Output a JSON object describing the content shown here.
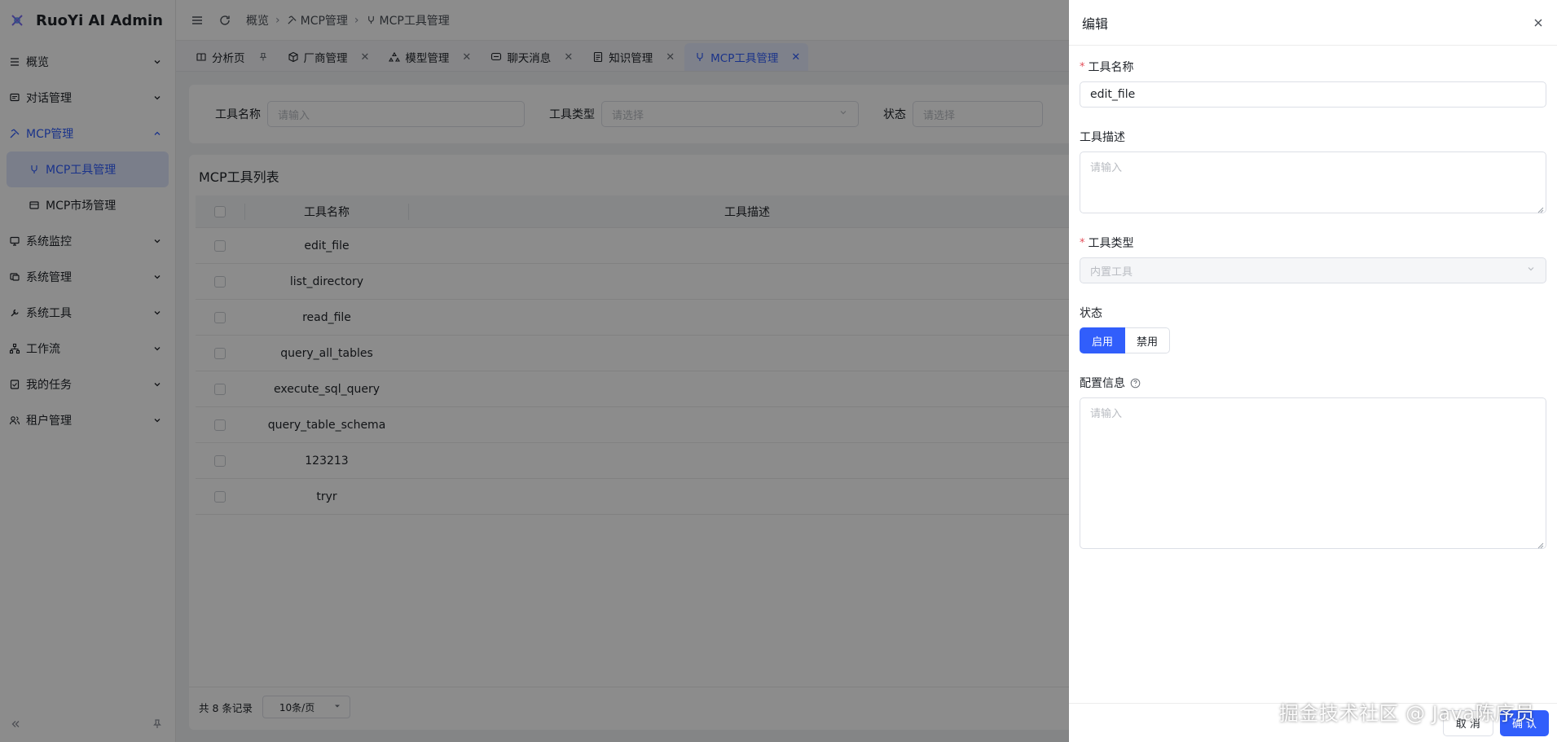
{
  "app": {
    "title": "RuoYi AI Admin"
  },
  "sidebar": {
    "items": [
      {
        "label": "概览",
        "icon": "menu-lines-icon"
      },
      {
        "label": "对话管理",
        "icon": "chat-icon"
      },
      {
        "label": "MCP管理",
        "icon": "mcp-icon"
      },
      {
        "label": "系统监控",
        "icon": "monitor-icon"
      },
      {
        "label": "系统管理",
        "icon": "settings-window-icon"
      },
      {
        "label": "系统工具",
        "icon": "wrench-icon"
      },
      {
        "label": "工作流",
        "icon": "workflow-icon"
      },
      {
        "label": "我的任务",
        "icon": "task-icon"
      },
      {
        "label": "租户管理",
        "icon": "users-icon"
      }
    ],
    "mcp_sub": [
      {
        "label": "MCP工具管理",
        "icon": "tool-icon"
      },
      {
        "label": "MCP市场管理",
        "icon": "store-icon"
      }
    ]
  },
  "breadcrumb": {
    "items": [
      "概览",
      "MCP管理",
      "MCP工具管理"
    ]
  },
  "tabs": [
    {
      "label": "分析页"
    },
    {
      "label": "厂商管理"
    },
    {
      "label": "模型管理"
    },
    {
      "label": "聊天消息"
    },
    {
      "label": "知识管理"
    },
    {
      "label": "MCP工具管理"
    }
  ],
  "search": {
    "name_label": "工具名称",
    "name_placeholder": "请输入",
    "type_label": "工具类型",
    "type_placeholder": "请选择",
    "status_label": "状态",
    "status_placeholder": "请选择"
  },
  "table": {
    "title": "MCP工具列表",
    "columns": {
      "name": "工具名称",
      "desc": "工具描述"
    },
    "rows": [
      "edit_file",
      "list_directory",
      "read_file",
      "query_all_tables",
      "execute_sql_query",
      "query_table_schema",
      "123213",
      "tryr"
    ],
    "total": "共 8 条记录",
    "page_size": "10条/页"
  },
  "drawer": {
    "title": "编辑",
    "name_label": "工具名称",
    "name_value": "edit_file",
    "desc_label": "工具描述",
    "desc_placeholder": "请输入",
    "type_label": "工具类型",
    "type_value": "内置工具",
    "status_label": "状态",
    "status_on": "启用",
    "status_off": "禁用",
    "config_label": "配置信息",
    "config_placeholder": "请输入",
    "cancel": "取 消",
    "ok": "确 认",
    "required_mark": "*"
  },
  "watermark": "掘金技术社区 @ Java陈序员",
  "colors": {
    "accent": "#315efb",
    "overlay": "rgba(0,0,0,0.45)"
  }
}
